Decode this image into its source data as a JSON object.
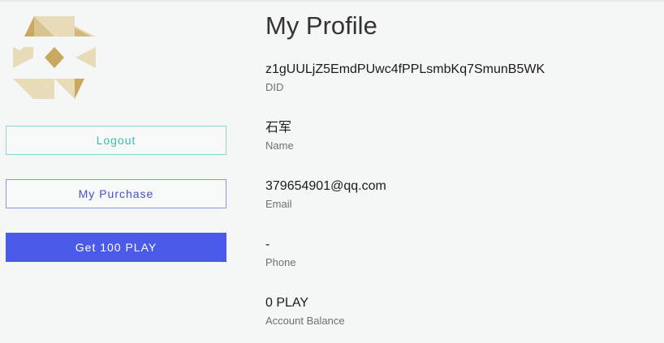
{
  "profile": {
    "title": "My Profile",
    "fields": [
      {
        "value": "z1gUULjZ5EmdPUwc4fPPLsmbKq7SmunB5WK",
        "label": "DID"
      },
      {
        "value": "石军",
        "label": "Name"
      },
      {
        "value": "379654901@qq.com",
        "label": "Email"
      },
      {
        "value": "-",
        "label": "Phone"
      },
      {
        "value": "0 PLAY",
        "label": "Account Balance"
      }
    ]
  },
  "sidebar": {
    "avatar_icon": "geometric-identicon",
    "logout_label": "Logout",
    "purchase_label": "My Purchase",
    "get_play_label": "Get 100 PLAY"
  },
  "colors": {
    "background": "#f5f7f7",
    "logout_accent": "#35bfb0",
    "purchase_accent": "#4350d0",
    "primary_button": "#4a5bea",
    "avatar_gold": "#c9a860",
    "avatar_light": "#e8dbb8"
  }
}
